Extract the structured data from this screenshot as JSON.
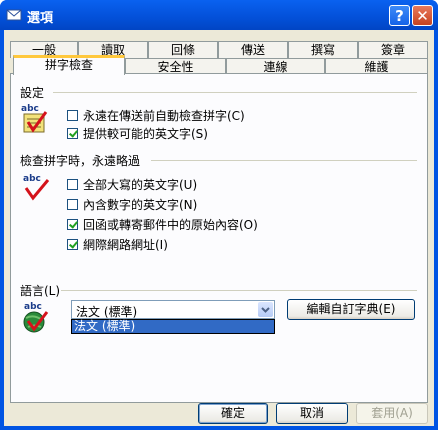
{
  "window": {
    "title": "選項"
  },
  "titlebar": {
    "help_label": "?",
    "close_label": "✕"
  },
  "tabs_row1": [
    "一般",
    "讀取",
    "回條",
    "傳送",
    "撰寫",
    "簽章"
  ],
  "tabs_row2": [
    "拼字檢查",
    "安全性",
    "連線",
    "維護"
  ],
  "active_tab": "拼字檢查",
  "settings": {
    "title": "設定",
    "options": [
      {
        "label": "永遠在傳送前自動檢查拼字(C)",
        "checked": false
      },
      {
        "label": "提供較可能的英文字(S)",
        "checked": true
      }
    ]
  },
  "ignore": {
    "title": "檢查拼字時，永遠略過",
    "options": [
      {
        "label": "全部大寫的英文字(U)",
        "checked": false
      },
      {
        "label": "內含數字的英文字(N)",
        "checked": false
      },
      {
        "label": "回函或轉寄郵件中的原始內容(O)",
        "checked": true
      },
      {
        "label": "網際網路網址(I)",
        "checked": true
      }
    ]
  },
  "language": {
    "title": "語言(L)",
    "selected": "法文 (標準)",
    "dropdown_items": [
      "法文 (標準)"
    ],
    "edit_dictionary_label": "編輯自訂字典(E)"
  },
  "buttons": {
    "ok": "確定",
    "cancel": "取消",
    "apply": "套用(A)"
  },
  "icons": {
    "abc_label": "abc"
  },
  "colors": {
    "titlebar": "#0054e3",
    "active_tab_accent": "#ffc83c",
    "selection": "#316ac5",
    "check": "#21a121"
  }
}
